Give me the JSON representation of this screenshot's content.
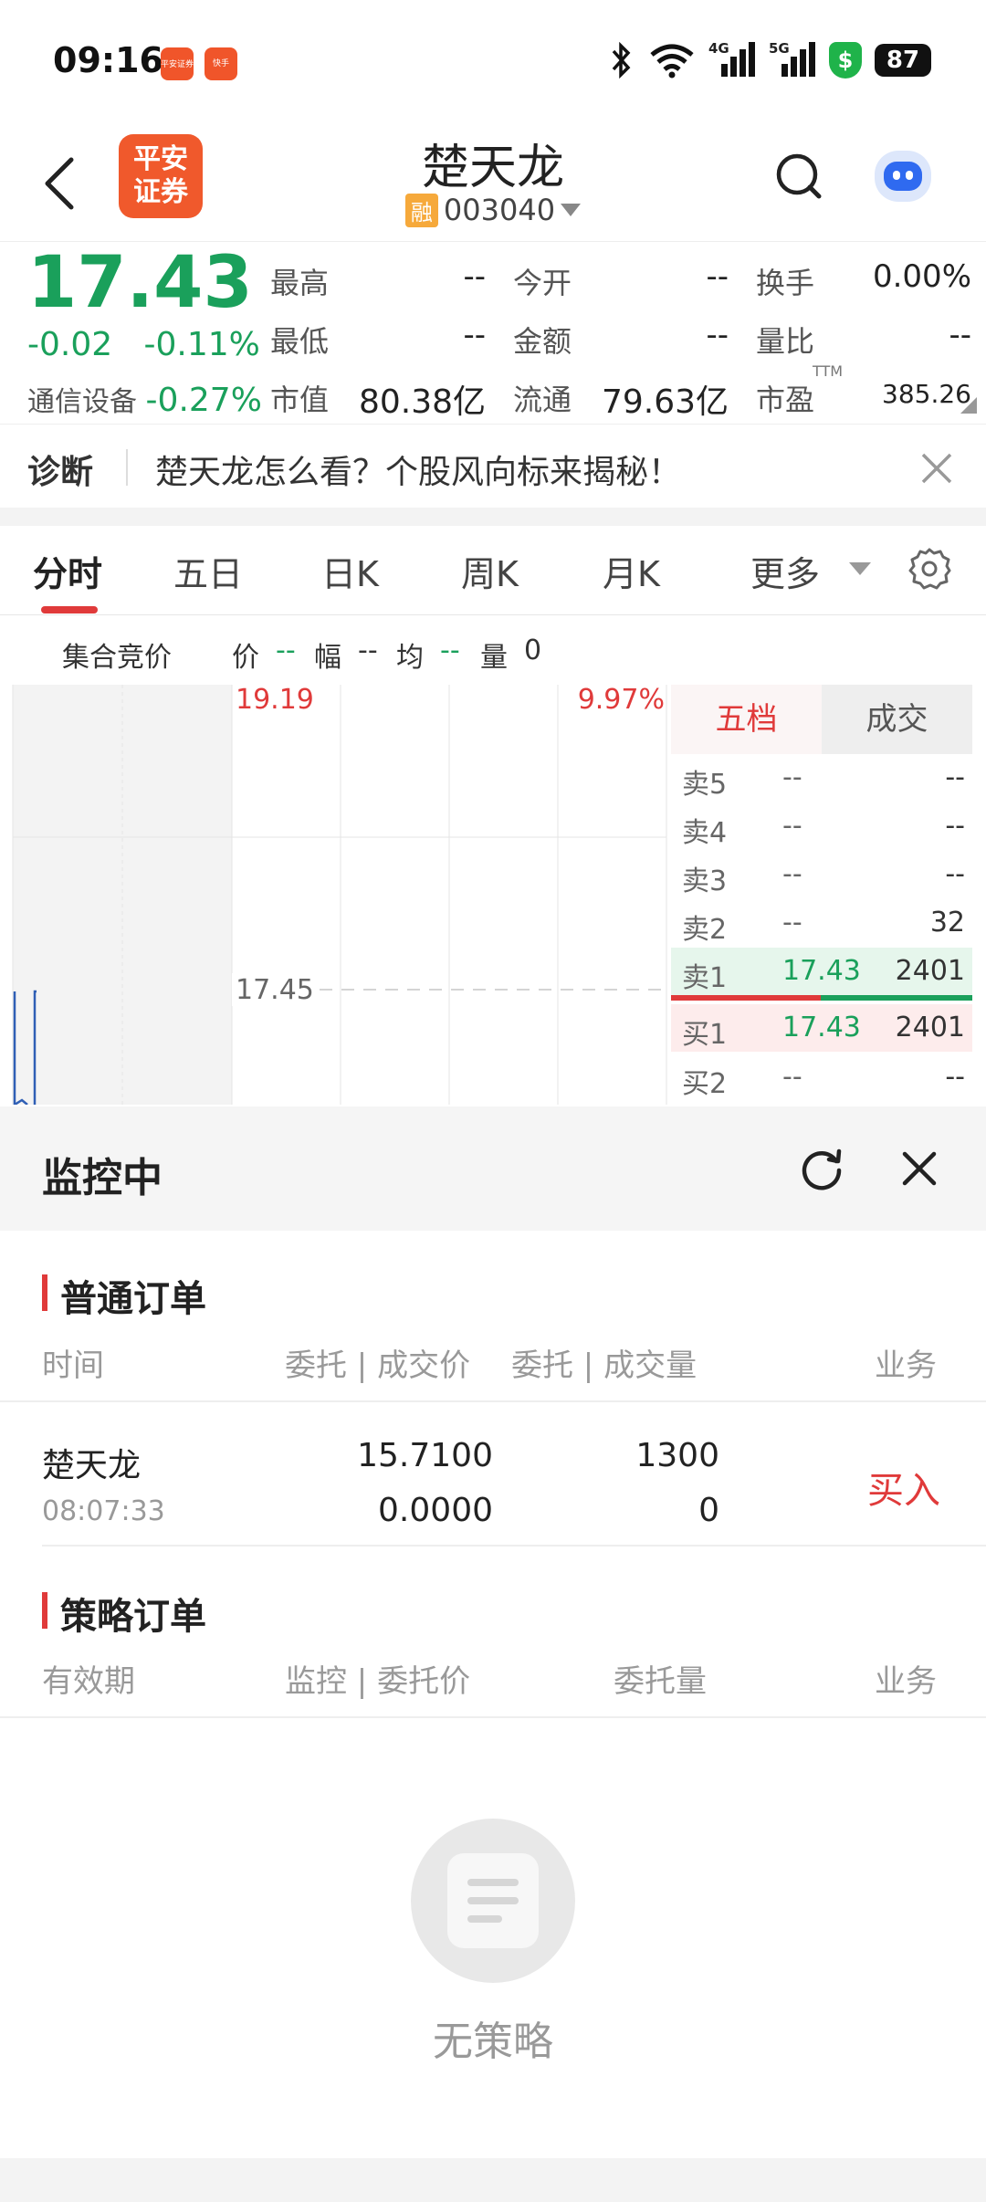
{
  "status": {
    "time": "09:16",
    "app1": "平安证券",
    "app2": "快手",
    "net1": "4G",
    "net2": "5G",
    "shield": "$",
    "battery": "87"
  },
  "header": {
    "logo_l1": "平安",
    "logo_l2": "证券",
    "name": "楚天龙",
    "rong": "融",
    "code": "003040"
  },
  "quote": {
    "price": "17.43",
    "change": "-0.02",
    "change_pct": "-0.11%",
    "industry": "通信设备",
    "industry_pct": "-0.27%",
    "grid": [
      {
        "label": "最高",
        "value": "--"
      },
      {
        "label": "今开",
        "value": "--"
      },
      {
        "label": "换手",
        "value": "0.00%"
      },
      {
        "label": "最低",
        "value": "--"
      },
      {
        "label": "金额",
        "value": "--"
      },
      {
        "label": "量比",
        "value": "--"
      },
      {
        "label": "市值",
        "value": "80.38亿"
      },
      {
        "label": "流通",
        "value": "79.63亿"
      },
      {
        "label": "市盈",
        "value": "385.26"
      }
    ],
    "ttm": "TTM"
  },
  "diagnosis": {
    "label": "诊断",
    "text": "楚天龙怎么看？个股风向标来揭秘！"
  },
  "tabs": [
    "分时",
    "五日",
    "日K",
    "周K",
    "月K",
    "更多"
  ],
  "intraday": {
    "auction": "集合竞价",
    "price_l": "价",
    "price_v": "--",
    "amp_l": "幅",
    "amp_v": "--",
    "avg_l": "均",
    "avg_v": "--",
    "vol_l": "量",
    "vol_v": "0"
  },
  "chart": {
    "top_price": "19.19",
    "top_pct": "9.97%",
    "mid_price": "17.45",
    "colors": {
      "up": "#e03a3a",
      "down": "#1aa05b",
      "line": "#2f5fb5"
    }
  },
  "orderbook": {
    "tabs": [
      "五档",
      "成交"
    ],
    "rows": [
      {
        "label": "卖5",
        "price": "--",
        "vol": "--"
      },
      {
        "label": "卖4",
        "price": "--",
        "vol": "--"
      },
      {
        "label": "卖3",
        "price": "--",
        "vol": "--"
      },
      {
        "label": "卖2",
        "price": "--",
        "vol": "32"
      },
      {
        "label": "卖1",
        "price": "17.43",
        "vol": "2401"
      },
      {
        "label": "买1",
        "price": "17.43",
        "vol": "2401"
      },
      {
        "label": "买2",
        "price": "--",
        "vol": "--"
      }
    ]
  },
  "monitor": {
    "title": "监控中",
    "normal": {
      "title": "普通订单",
      "cols": [
        "时间",
        "委托 | 成交价",
        "委托 | 成交量",
        "业务"
      ],
      "row": {
        "name": "楚天龙",
        "time": "08:07:33",
        "price1": "15.7100",
        "price2": "0.0000",
        "vol1": "1300",
        "vol2": "0",
        "action": "买入"
      }
    },
    "strategy": {
      "title": "策略订单",
      "cols": [
        "有效期",
        "监控 | 委托价",
        "委托量",
        "业务"
      ]
    },
    "empty": "无策略"
  }
}
